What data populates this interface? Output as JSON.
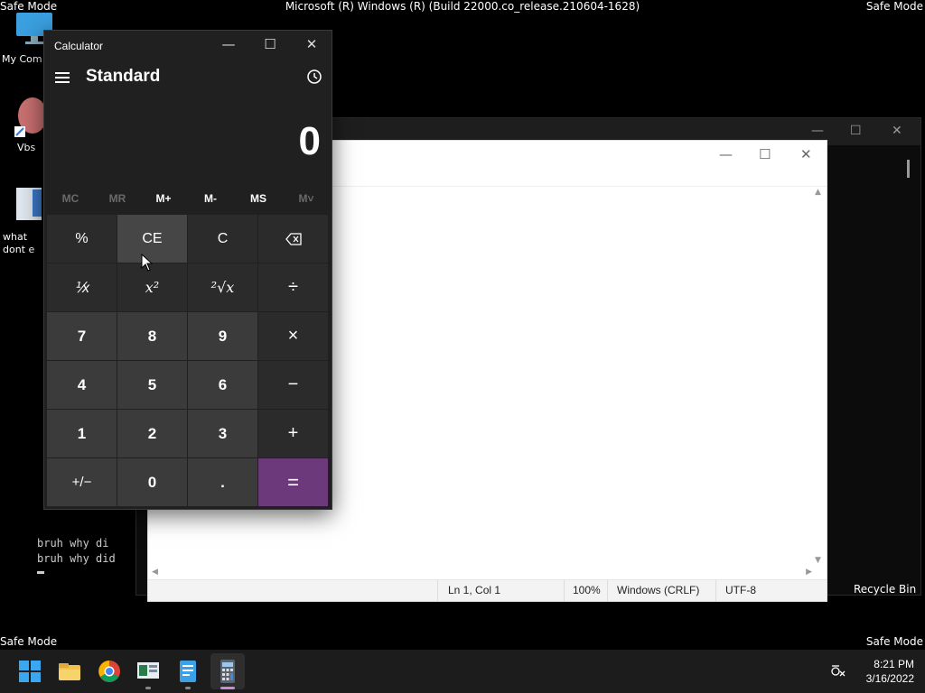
{
  "desktop": {
    "safe_mode_label": "Safe Mode",
    "build_text": "Microsoft (R) Windows (R) (Build 22000.co_release.210604-1628)",
    "icons": [
      {
        "label": "My Com"
      },
      {
        "label": "Vbs"
      },
      {
        "label": "what\ndont e"
      }
    ],
    "recycle_bin_label": "Recycle Bin"
  },
  "console": {
    "lines": [
      "bruh why di",
      "bruh why did"
    ]
  },
  "notepad": {
    "status": {
      "position": "Ln 1, Col 1",
      "zoom": "100%",
      "line_ending": "Windows (CRLF)",
      "encoding": "UTF-8"
    }
  },
  "calculator": {
    "title": "Calculator",
    "mode": "Standard",
    "display": "0",
    "memory": [
      "MC",
      "MR",
      "M+",
      "M-",
      "MS",
      "M˅"
    ],
    "keys": [
      "%",
      "CE",
      "C",
      "⌫",
      "⅟x",
      "x²",
      "²√x",
      "÷",
      "7",
      "8",
      "9",
      "×",
      "4",
      "5",
      "6",
      "−",
      "1",
      "2",
      "3",
      "+",
      "+/−",
      "0",
      ".",
      "="
    ],
    "accent_color": "#6c3a7a"
  },
  "taskbar": {
    "time": "8:21 PM",
    "date": "3/16/2022"
  }
}
